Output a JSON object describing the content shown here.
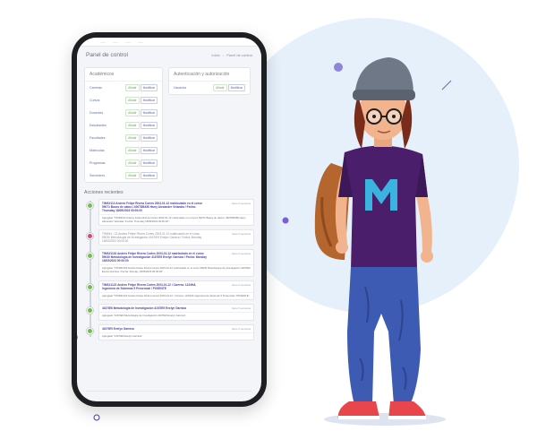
{
  "app": {
    "page_title": "Panel de control",
    "breadcrumb": [
      "Inicio",
      "Panel de control"
    ]
  },
  "academicos": {
    "title": "Académicos",
    "items": [
      {
        "label": "Carreras",
        "add": "Añadir",
        "edit": "Modificar"
      },
      {
        "label": "Cursos",
        "add": "Añadir",
        "edit": "Modificar"
      },
      {
        "label": "Docentes",
        "add": "Añadir",
        "edit": "Modificar"
      },
      {
        "label": "Estudiantes",
        "add": "Añadir",
        "edit": "Modificar"
      },
      {
        "label": "Facultades",
        "add": "Añadir",
        "edit": "Modificar"
      },
      {
        "label": "Matrículas",
        "add": "Añadir",
        "edit": "Modificar"
      },
      {
        "label": "Programas",
        "add": "Añadir",
        "edit": "Modificar"
      },
      {
        "label": "Semestres",
        "add": "Añadir",
        "edit": "Modificar"
      }
    ]
  },
  "autenticacion": {
    "title": "Autenticación y autorización",
    "items": [
      {
        "label": "Usuarios",
        "add": "Añadir",
        "edit": "Modificar"
      }
    ]
  },
  "recent": {
    "title": "Acciones recientes",
    "events": [
      {
        "color": "#6fbf4a",
        "title": "TIMS#113 Andres Felipe Rivera Cortes 2003-01-12 matriculado en el curso 59071 Bases de datos I 4007DB456 Harry Alexander Velandia / Fecha: Thursday 18/05/2023 00:00:00",
        "time": "Hace 5 semanas",
        "body": "Agregado \"TIMS#113 Andres Felipe Rivera Cortes 2003-01-12 matriculado en el curso 59071 Bases de datos I 4007DB456 Harry Alexander Velandia / Fecha: Thursday 18/05/2023 00:00:00\"."
      },
      {
        "color": "#d94b6a",
        "title": "TIMS#1 / 22 Andres Felipe Rivera Cortes 2003-01-12 matriculado en el curso 59030 Metodología de Investigación 4167IE9 Evelyn Garnica / Fecha: Monday 15/05/2023 00:00:00",
        "time": "Hace 5 semanas",
        "body": "",
        "muted": true
      },
      {
        "color": "#6fbf4a",
        "title": "TIMS#1133 Andres Felipe Rivera Cortes 2003-01-12 matriculado en el curso 59030 Metodología de Investigación 4167IE9 Evelyn Garnica / Fecha: Monday 15/05/2023 00:00:00",
        "time": "Hace 5 semanas",
        "body": "Agregado \"TIMS#1133 Andres Felipe Rivera Cortes 2003-01-12 matriculado en el curso 59030 Metodología de Investigación 4167IE9 Evelyn Garnica / Fecha: Monday 15/05/2023 00:00:00\"."
      },
      {
        "color": "#6fbf4a",
        "title": "TIMS#1122 Andres Felipe Rivera Cortes 2003-01-12 / Carrera: 1224HA Ingeniería de Sistemas 5 Presencial / POSENTE",
        "time": "Hace 5 semanas",
        "body": "Agregado \"TIMS#1122 Andres Felipe Rivera Cortes 2003-01-12 / Carrera: 1224HA Ingeniería de Sistemas 5 Presencial / POSENTE\"."
      },
      {
        "color": "#6fbf4a",
        "title": "4167IE6 Metodología de Investigación 4167IE9 Evelyn Garnica",
        "time": "Hace 5 semanas",
        "body": "Agregado \"4167IE6 Metodología de Investigación 4167IE9 Evelyn Garnica\"."
      },
      {
        "color": "#6fbf4a",
        "title": "4167IE9 Evelyn Garnica",
        "time": "Hace 5 semanas",
        "body": "Agregado \"4167IE9 Evelyn Garnica\"."
      }
    ]
  },
  "colors": {
    "accent_purple": "#4a3fa6",
    "add_green": "#68a35c",
    "blob_blue": "#e6f0fb",
    "deco_pink": "#e0267a"
  }
}
